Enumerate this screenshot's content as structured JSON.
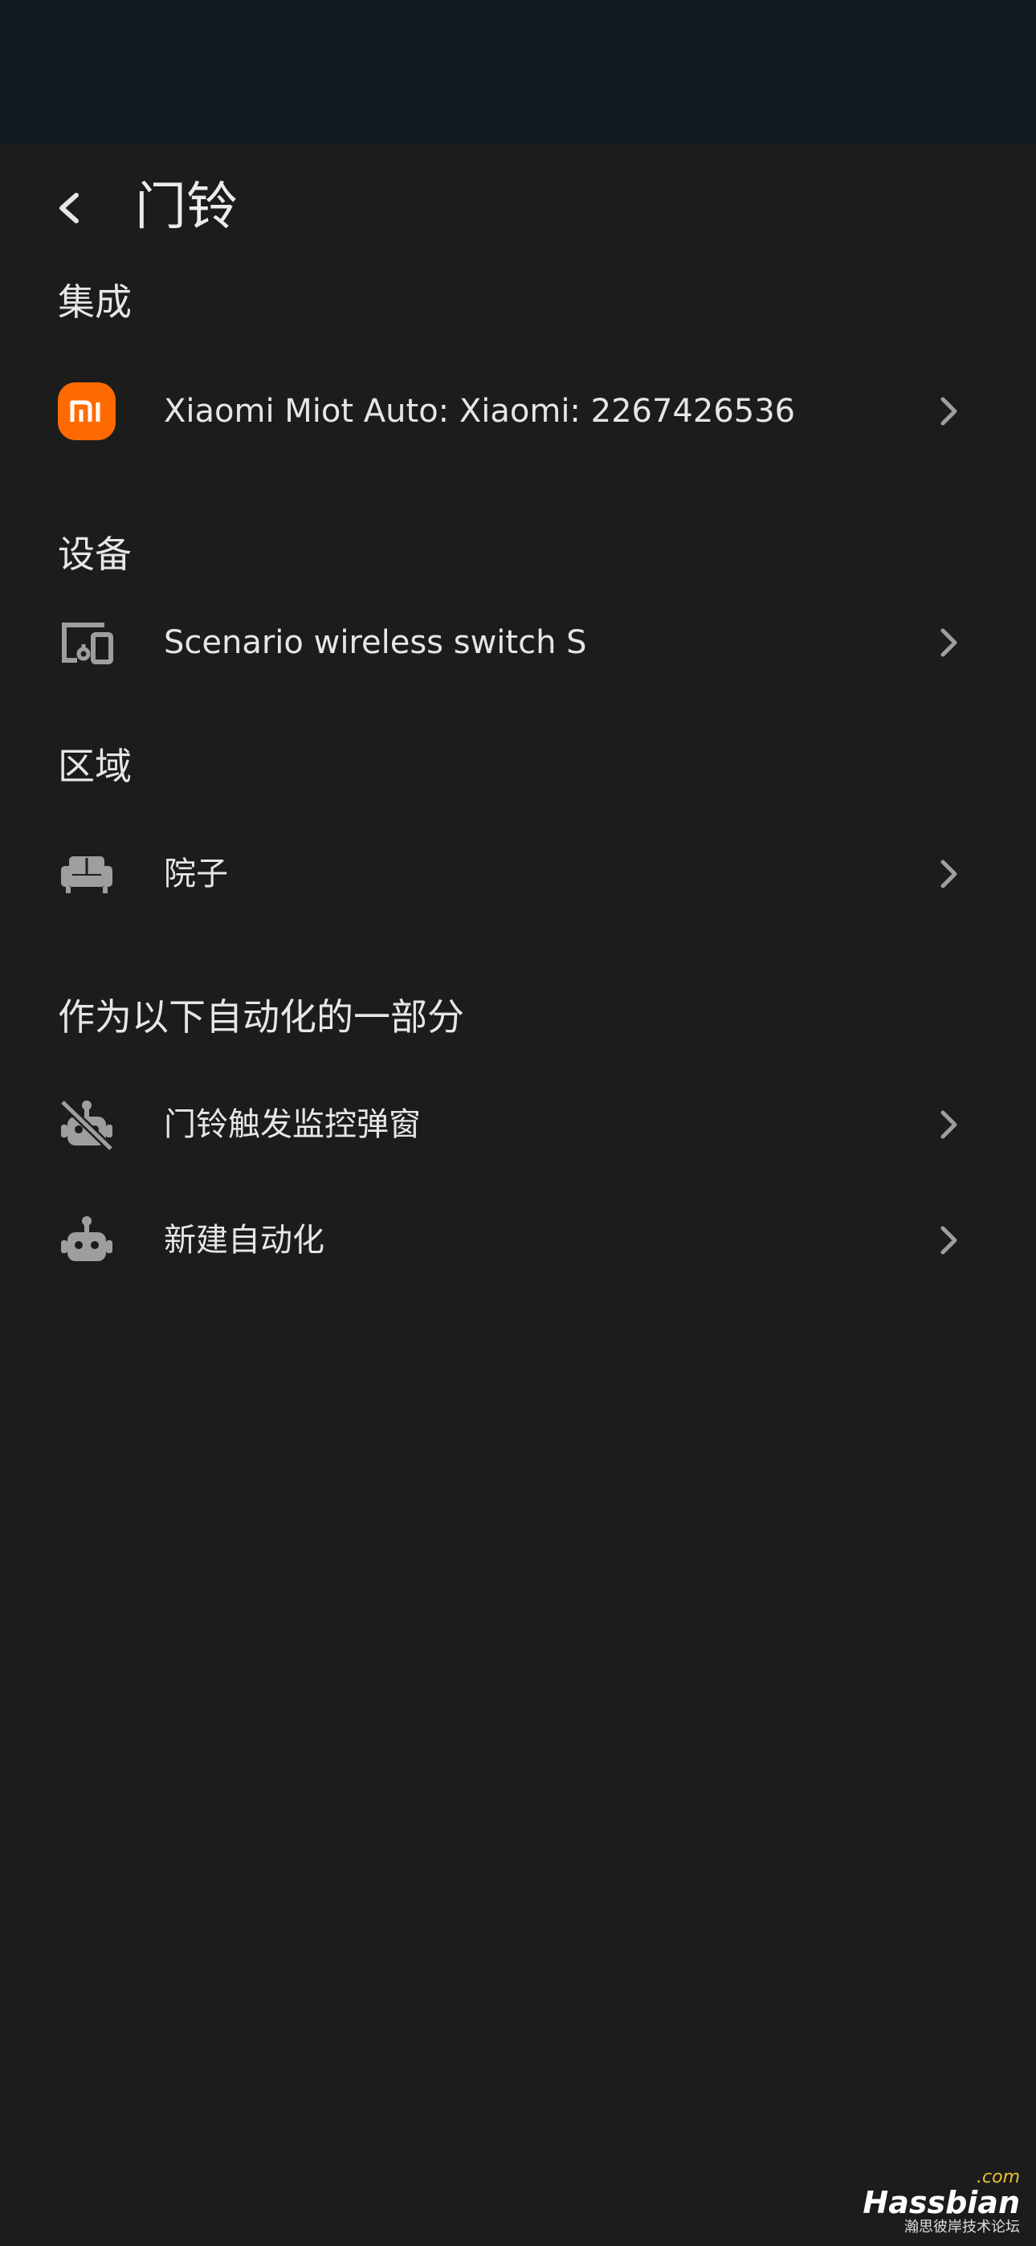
{
  "header": {
    "title": "门铃"
  },
  "sections": {
    "integration": {
      "title": "集成",
      "items": [
        {
          "label": "Xiaomi Miot Auto: Xiaomi: 2267426536",
          "icon": "xiaomi-logo-icon"
        }
      ]
    },
    "device": {
      "title": "设备",
      "items": [
        {
          "label": "Scenario wireless switch S",
          "icon": "devices-icon"
        }
      ]
    },
    "area": {
      "title": "区域",
      "items": [
        {
          "label": "院子",
          "icon": "sofa-icon"
        }
      ]
    },
    "automations": {
      "title": "作为以下自动化的一部分",
      "items": [
        {
          "label": "门铃触发监控弹窗",
          "icon": "robot-off-icon"
        },
        {
          "label": "新建自动化",
          "icon": "robot-icon"
        }
      ]
    }
  },
  "watermark": {
    "com": ".com",
    "brand": "Hassbian",
    "sub": "瀚思彼岸技术论坛"
  },
  "colors": {
    "background": "#1c1c1c",
    "status_bar": "#101a20",
    "xiaomi_orange": "#ff6a00",
    "icon_gray": "#9e9e9e",
    "text": "#e6e6e6"
  }
}
